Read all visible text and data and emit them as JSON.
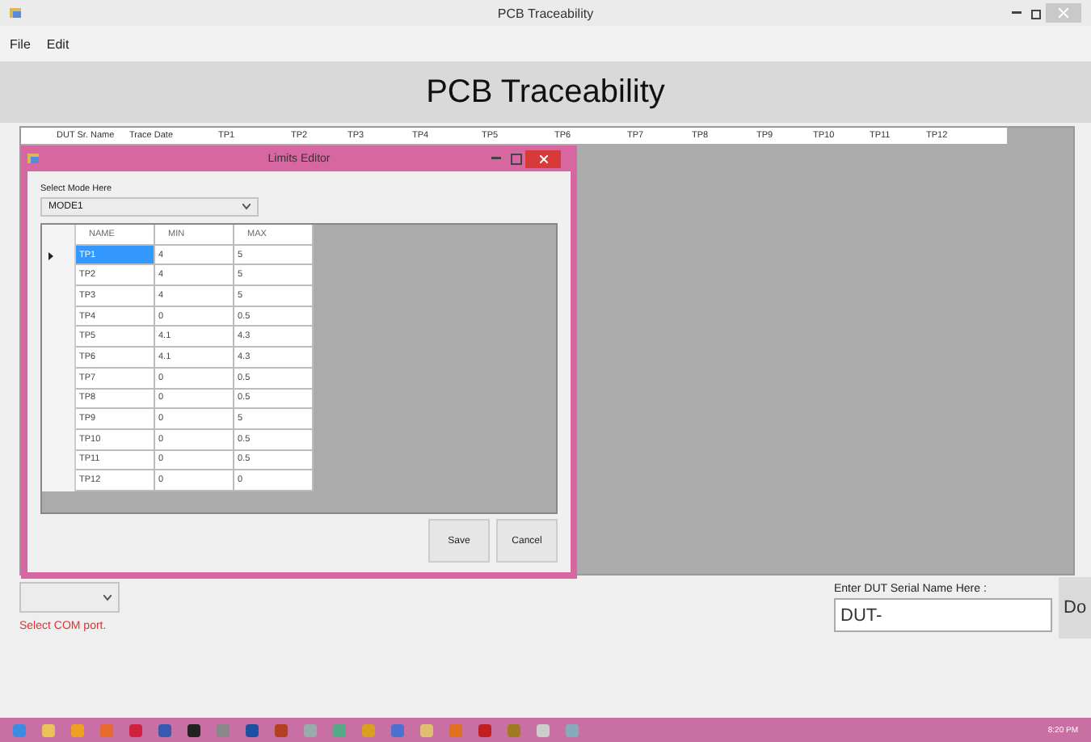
{
  "window": {
    "title": "PCB Traceability"
  },
  "menu": [
    "File",
    "Edit"
  ],
  "header": "PCB Traceability",
  "main_grid": {
    "columns": [
      "DUT Sr. Name",
      "Trace Date",
      "TP1",
      "TP2",
      "TP3",
      "TP4",
      "TP5",
      "TP6",
      "TP7",
      "TP8",
      "TP9",
      "TP10",
      "TP11",
      "TP12"
    ]
  },
  "dialog": {
    "title": "Limits Editor",
    "mode_label": "Select Mode Here",
    "mode_value": "MODE1",
    "columns": [
      "NAME",
      "MIN",
      "MAX"
    ],
    "rows": [
      {
        "name": "TP1",
        "min": "4",
        "max": "5",
        "selected": true
      },
      {
        "name": "TP2",
        "min": "4",
        "max": "5",
        "selected": false
      },
      {
        "name": "TP3",
        "min": "4",
        "max": "5",
        "selected": false
      },
      {
        "name": "TP4",
        "min": "0",
        "max": "0.5",
        "selected": false
      },
      {
        "name": "TP5",
        "min": "4.1",
        "max": "4.3",
        "selected": false
      },
      {
        "name": "TP6",
        "min": "4.1",
        "max": "4.3",
        "selected": false
      },
      {
        "name": "TP7",
        "min": "0",
        "max": "0.5",
        "selected": false
      },
      {
        "name": "TP8",
        "min": "0",
        "max": "0.5",
        "selected": false
      },
      {
        "name": "TP9",
        "min": "0",
        "max": "5",
        "selected": false
      },
      {
        "name": "TP10",
        "min": "0",
        "max": "0.5",
        "selected": false
      },
      {
        "name": "TP11",
        "min": "0",
        "max": "0.5",
        "selected": false
      },
      {
        "name": "TP12",
        "min": "0",
        "max": "0",
        "selected": false
      }
    ],
    "buttons": [
      "Save",
      "Cancel"
    ]
  },
  "com_port": {
    "status": "Select COM port."
  },
  "serial": {
    "label": "Enter DUT Serial Name Here :",
    "value": "DUT-"
  },
  "action_button": "Do",
  "taskbar": {
    "clock": "8:20 PM"
  }
}
